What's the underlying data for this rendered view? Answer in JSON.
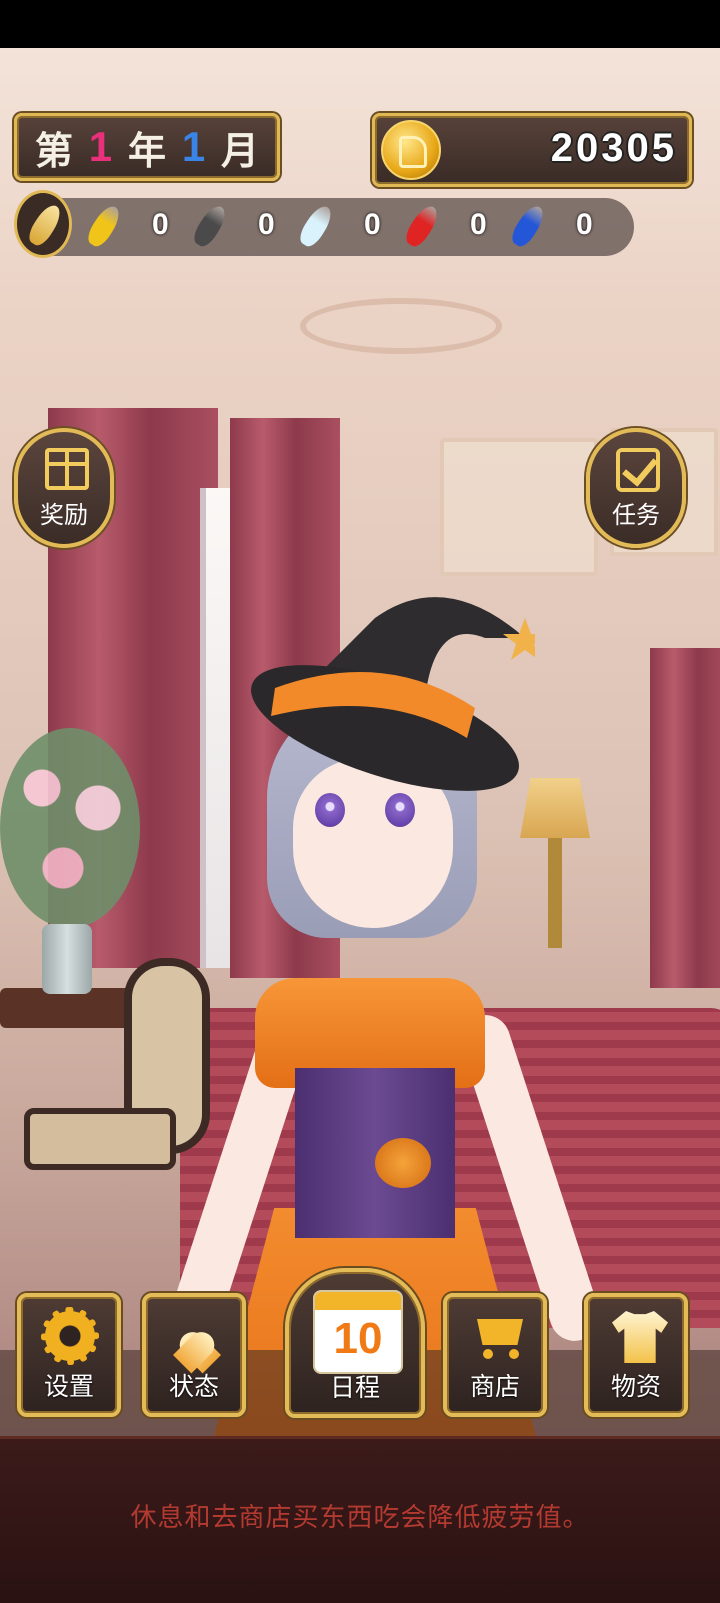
{
  "date": {
    "prefix": "第",
    "year": "1",
    "year_unit": "年",
    "month": "1",
    "month_unit": "月"
  },
  "coins": "20305",
  "feathers": [
    {
      "name": "gold-feather",
      "color": "#f0c419",
      "count": "0"
    },
    {
      "name": "black-feather",
      "color": "#4a4a4a",
      "count": "0"
    },
    {
      "name": "white-feather",
      "color": "#d9f2fb",
      "count": "0"
    },
    {
      "name": "red-feather",
      "color": "#e02424",
      "count": "0"
    },
    {
      "name": "blue-feather",
      "color": "#2456d8",
      "count": "0"
    }
  ],
  "side_buttons": {
    "reward": "奖励",
    "task": "任务"
  },
  "nav": {
    "settings": "设置",
    "status": "状态",
    "schedule": "日程",
    "calendar_day": "10",
    "shop": "商店",
    "items": "物资"
  },
  "hint": "休息和去商店买东西吃会降低疲劳值。",
  "colors": {
    "gold_border": "#e0b955",
    "hint_text": "#b33a30"
  }
}
